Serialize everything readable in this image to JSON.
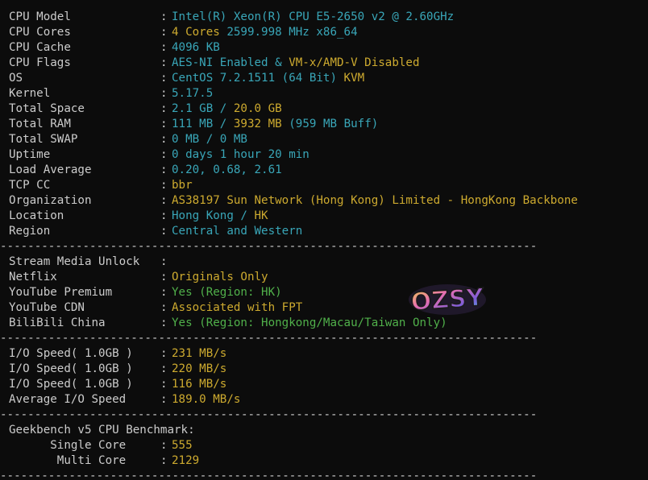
{
  "separator": "------------------------------------------------------------------------------",
  "system": {
    "cpu_model": {
      "label": "CPU Model",
      "value": "Intel(R) Xeon(R) CPU E5-2650 v2 @ 2.60GHz"
    },
    "cpu_cores": {
      "label": "CPU Cores",
      "value_a": "4 Cores",
      "value_b": "2599.998 MHz x86_64"
    },
    "cpu_cache": {
      "label": "CPU Cache",
      "value": "4096 KB"
    },
    "cpu_flags": {
      "label": "CPU Flags",
      "value_a": "AES-NI Enabled &",
      "value_b": "VM-x/AMD-V Disabled"
    },
    "os": {
      "label": "OS",
      "value_a": "CentOS 7.2.1511 (64 Bit)",
      "value_b": "KVM"
    },
    "kernel": {
      "label": "Kernel",
      "value": "5.17.5"
    },
    "total_space": {
      "label": "Total Space",
      "value_a": "2.1 GB /",
      "value_b": "20.0 GB"
    },
    "total_ram": {
      "label": "Total RAM",
      "value_a": "111 MB /",
      "value_b": "3932 MB",
      "value_c": "(959 MB Buff)"
    },
    "total_swap": {
      "label": "Total SWAP",
      "value": "0 MB / 0 MB"
    },
    "uptime": {
      "label": "Uptime",
      "value": "0 days 1 hour 20 min"
    },
    "load_average": {
      "label": "Load Average",
      "value": "0.20, 0.68, 2.61"
    },
    "tcp_cc": {
      "label": "TCP CC",
      "value": "bbr"
    },
    "organization": {
      "label": "Organization",
      "value": "AS38197 Sun Network (Hong Kong) Limited - HongKong Backbone"
    },
    "location": {
      "label": "Location",
      "value_a": "Hong Kong /",
      "value_b": "HK"
    },
    "region": {
      "label": "Region",
      "value": "Central and Western"
    }
  },
  "media": {
    "header": {
      "label": "Stream Media Unlock",
      "colon": ":"
    },
    "netflix": {
      "label": "Netflix",
      "value": "Originals Only"
    },
    "youtube_premium": {
      "label": "YouTube Premium",
      "value": "Yes (Region: HK)"
    },
    "youtube_cdn": {
      "label": "YouTube CDN",
      "value": "Associated with FPT"
    },
    "bilibili": {
      "label": "BiliBili China",
      "value": "Yes (Region: Hongkong/Macau/Taiwan Only)"
    }
  },
  "io": {
    "run1": {
      "label": "I/O Speed( 1.0GB )",
      "value": "231 MB/s"
    },
    "run2": {
      "label": "I/O Speed( 1.0GB )",
      "value": "220 MB/s"
    },
    "run3": {
      "label": "I/O Speed( 1.0GB )",
      "value": "116 MB/s"
    },
    "average": {
      "label": "Average I/O Speed",
      "value": "189.0 MB/s"
    }
  },
  "geekbench": {
    "header": "Geekbench v5 CPU Benchmark:",
    "single": {
      "label": "Single Core",
      "value": "555"
    },
    "multi": {
      "label": "Multi Core",
      "value": "2129"
    }
  },
  "logo": {
    "text": "OZSY"
  },
  "colors": {
    "background": "#0c0c0c",
    "text": "#cccccc",
    "cyan": "#39a6b8",
    "yellow": "#cdaa2f",
    "green": "#50b04a"
  }
}
